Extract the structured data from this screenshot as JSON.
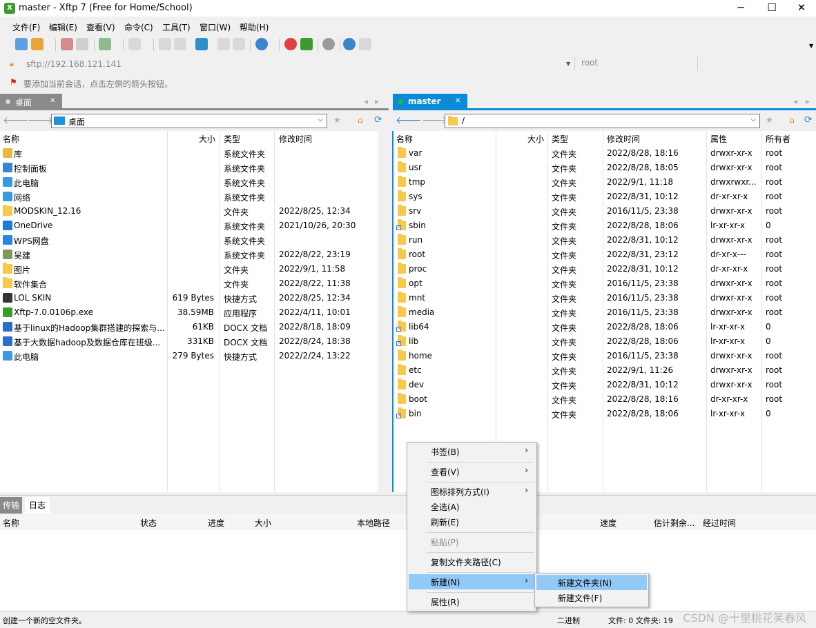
{
  "window": {
    "title": "master - Xftp 7 (Free for Home/School)",
    "minimize": "─",
    "maximize": "☐",
    "close": "✕"
  },
  "menu": [
    "文件(F)",
    "编辑(E)",
    "查看(V)",
    "命令(C)",
    "工具(T)",
    "窗口(W)",
    "帮助(H)"
  ],
  "address": {
    "url": "sftp://192.168.121.141",
    "user": "root"
  },
  "hint": "要添加当前会话，点击左侧的箭头按钮。",
  "left": {
    "tab": "桌面",
    "path": "桌面",
    "columns": [
      "名称",
      "大小",
      "类型",
      "修改时间"
    ],
    "rows": [
      {
        "name": "库",
        "size": "",
        "type": "系统文件夹",
        "mtime": "",
        "icon": "library-icon"
      },
      {
        "name": "控制面板",
        "size": "",
        "type": "系统文件夹",
        "mtime": "",
        "icon": "control-panel-icon"
      },
      {
        "name": "此电脑",
        "size": "",
        "type": "系统文件夹",
        "mtime": "",
        "icon": "computer-icon"
      },
      {
        "name": "网络",
        "size": "",
        "type": "系统文件夹",
        "mtime": "",
        "icon": "network-icon"
      },
      {
        "name": "MODSKIN_12.16",
        "size": "",
        "type": "文件夹",
        "mtime": "2022/8/25, 12:34",
        "icon": "folder-icon"
      },
      {
        "name": "OneDrive",
        "size": "",
        "type": "系统文件夹",
        "mtime": "2021/10/26, 20:30",
        "icon": "onedrive-icon"
      },
      {
        "name": "WPS网盘",
        "size": "",
        "type": "系统文件夹",
        "mtime": "",
        "icon": "wps-cloud-icon"
      },
      {
        "name": "吴建",
        "size": "",
        "type": "系统文件夹",
        "mtime": "2022/8/22, 23:19",
        "icon": "user-icon"
      },
      {
        "name": "图片",
        "size": "",
        "type": "文件夹",
        "mtime": "2022/9/1, 11:58",
        "icon": "folder-icon"
      },
      {
        "name": "软件集合",
        "size": "",
        "type": "文件夹",
        "mtime": "2022/8/22, 11:38",
        "icon": "folder-icon"
      },
      {
        "name": "LOL SKIN",
        "size": "619 Bytes",
        "type": "快捷方式",
        "mtime": "2022/8/25, 12:34",
        "icon": "shortcut-icon"
      },
      {
        "name": "Xftp-7.0.0106p.exe",
        "size": "38.59MB",
        "type": "应用程序",
        "mtime": "2022/4/11, 10:01",
        "icon": "xftp-icon"
      },
      {
        "name": "基于linux的Hadoop集群搭建的探索与...",
        "size": "61KB",
        "type": "DOCX 文档",
        "mtime": "2022/8/18, 18:09",
        "icon": "docx-icon"
      },
      {
        "name": "基于大数据hadoop及数据仓库在班级...",
        "size": "331KB",
        "type": "DOCX 文档",
        "mtime": "2022/8/24, 18:38",
        "icon": "docx-icon"
      },
      {
        "name": "此电脑",
        "size": "279 Bytes",
        "type": "快捷方式",
        "mtime": "2022/2/24, 13:22",
        "icon": "computer-icon"
      }
    ]
  },
  "right": {
    "tab": "master",
    "path": "/",
    "columns": [
      "名称",
      "大小",
      "类型",
      "修改时间",
      "属性",
      "所有者"
    ],
    "rows": [
      {
        "name": "var",
        "type": "文件夹",
        "mtime": "2022/8/28, 18:16",
        "attr": "drwxr-xr-x",
        "owner": "root",
        "link": false
      },
      {
        "name": "usr",
        "type": "文件夹",
        "mtime": "2022/8/28, 18:05",
        "attr": "drwxr-xr-x",
        "owner": "root",
        "link": false
      },
      {
        "name": "tmp",
        "type": "文件夹",
        "mtime": "2022/9/1, 11:18",
        "attr": "drwxrwxr...",
        "owner": "root",
        "link": false
      },
      {
        "name": "sys",
        "type": "文件夹",
        "mtime": "2022/8/31, 10:12",
        "attr": "dr-xr-xr-x",
        "owner": "root",
        "link": false
      },
      {
        "name": "srv",
        "type": "文件夹",
        "mtime": "2016/11/5, 23:38",
        "attr": "drwxr-xr-x",
        "owner": "root",
        "link": false
      },
      {
        "name": "sbin",
        "type": "文件夹",
        "mtime": "2022/8/28, 18:06",
        "attr": "lr-xr-xr-x",
        "owner": "0",
        "link": true
      },
      {
        "name": "run",
        "type": "文件夹",
        "mtime": "2022/8/31, 10:12",
        "attr": "drwxr-xr-x",
        "owner": "root",
        "link": false
      },
      {
        "name": "root",
        "type": "文件夹",
        "mtime": "2022/8/31, 23:12",
        "attr": "dr-xr-x---",
        "owner": "root",
        "link": false
      },
      {
        "name": "proc",
        "type": "文件夹",
        "mtime": "2022/8/31, 10:12",
        "attr": "dr-xr-xr-x",
        "owner": "root",
        "link": false
      },
      {
        "name": "opt",
        "type": "文件夹",
        "mtime": "2016/11/5, 23:38",
        "attr": "drwxr-xr-x",
        "owner": "root",
        "link": false
      },
      {
        "name": "mnt",
        "type": "文件夹",
        "mtime": "2016/11/5, 23:38",
        "attr": "drwxr-xr-x",
        "owner": "root",
        "link": false
      },
      {
        "name": "media",
        "type": "文件夹",
        "mtime": "2016/11/5, 23:38",
        "attr": "drwxr-xr-x",
        "owner": "root",
        "link": false
      },
      {
        "name": "lib64",
        "type": "文件夹",
        "mtime": "2022/8/28, 18:06",
        "attr": "lr-xr-xr-x",
        "owner": "0",
        "link": true
      },
      {
        "name": "lib",
        "type": "文件夹",
        "mtime": "2022/8/28, 18:06",
        "attr": "lr-xr-xr-x",
        "owner": "0",
        "link": true
      },
      {
        "name": "home",
        "type": "文件夹",
        "mtime": "2016/11/5, 23:38",
        "attr": "drwxr-xr-x",
        "owner": "root",
        "link": false
      },
      {
        "name": "etc",
        "type": "文件夹",
        "mtime": "2022/9/1, 11:26",
        "attr": "drwxr-xr-x",
        "owner": "root",
        "link": false
      },
      {
        "name": "dev",
        "type": "文件夹",
        "mtime": "2022/8/31, 10:12",
        "attr": "drwxr-xr-x",
        "owner": "root",
        "link": false
      },
      {
        "name": "boot",
        "type": "文件夹",
        "mtime": "2022/8/28, 18:16",
        "attr": "dr-xr-xr-x",
        "owner": "root",
        "link": false
      },
      {
        "name": "bin",
        "type": "文件夹",
        "mtime": "2022/8/28, 18:06",
        "attr": "lr-xr-xr-x",
        "owner": "0",
        "link": true
      }
    ]
  },
  "bottom_tabs": [
    "传输",
    "日志"
  ],
  "transfer_columns": [
    "名称",
    "状态",
    "进度",
    "大小",
    "本地路径",
    "速度",
    "估计剩余...",
    "经过时间"
  ],
  "context_menu": {
    "items": [
      "书签(B)",
      "查看(V)",
      "图标排列方式(I)",
      "全选(A)",
      "刷新(E)",
      "粘贴(P)",
      "复制文件夹路径(C)",
      "新建(N)",
      "属性(R)"
    ],
    "submenu": [
      "新建文件夹(N)",
      "新建文件(F)"
    ]
  },
  "status": {
    "left": "创建一个新的空文件夹。",
    "mode": "二进制",
    "count": "文件: 0  文件夹: 19"
  },
  "watermark": "CSDN @十里桃花笑春风",
  "colors": {
    "accent": "#0a8ad9",
    "green": "#20c020",
    "highlight": "#91c9f7"
  }
}
